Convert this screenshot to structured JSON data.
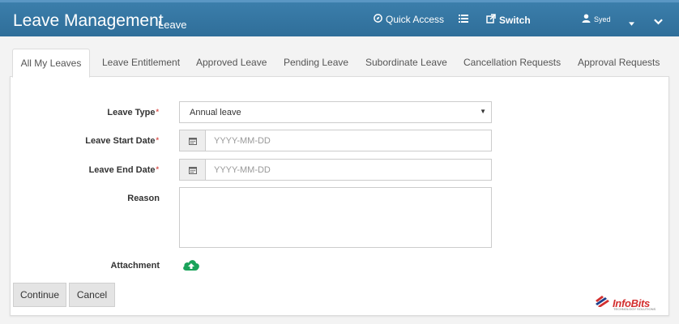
{
  "header": {
    "title": "Leave Management",
    "subtitle": "Leave",
    "quick_access": "Quick Access",
    "switch_label": "Switch",
    "user_name": "Syed"
  },
  "tabs": [
    {
      "label": "All My Leaves",
      "active": true
    },
    {
      "label": "Leave Entitlement",
      "active": false
    },
    {
      "label": "Approved Leave",
      "active": false
    },
    {
      "label": "Pending Leave",
      "active": false
    },
    {
      "label": "Subordinate Leave",
      "active": false
    },
    {
      "label": "Cancellation Requests",
      "active": false
    },
    {
      "label": "Approval Requests",
      "active": false
    }
  ],
  "form": {
    "leave_type_label": "Leave Type",
    "leave_type_value": "Annual leave",
    "start_date_label": "Leave Start Date",
    "start_date_placeholder": "YYYY-MM-DD",
    "end_date_label": "Leave End Date",
    "end_date_placeholder": "YYYY-MM-DD",
    "reason_label": "Reason",
    "reason_value": "",
    "attachment_label": "Attachment",
    "required_marker": "*"
  },
  "buttons": {
    "continue": "Continue",
    "cancel": "Cancel"
  },
  "logo": {
    "text": "InfoBits",
    "tagline": "TECHNOLOGY SOLUTIONS"
  },
  "colors": {
    "header_bg": "#3478a6",
    "required": "#d9534f",
    "upload_icon": "#1aa35a",
    "logo": "#d32f2f"
  }
}
